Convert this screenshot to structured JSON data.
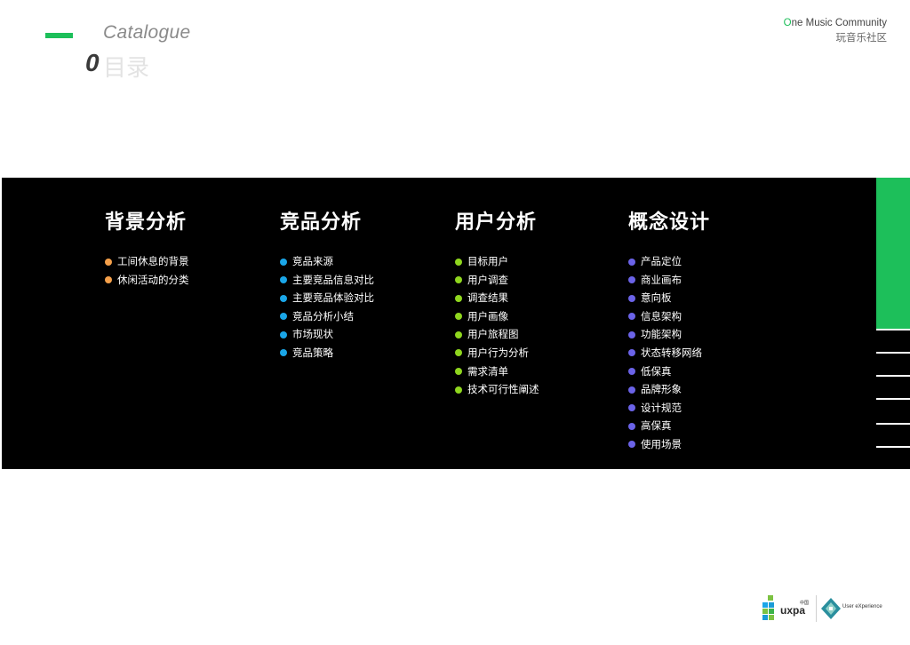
{
  "header": {
    "catalogue_label": "Catalogue",
    "index_number": "0",
    "index_text": "目录",
    "accent_color": "#1dbf5a"
  },
  "brand": {
    "name_first_letter": "O",
    "name_rest": "ne Music Community",
    "subtitle": "玩音乐社区"
  },
  "columns": [
    {
      "title": "背景分析",
      "dot_color": "#f5a04a",
      "items": [
        "工间休息的背景",
        "休闲活动的分类"
      ]
    },
    {
      "title": "竞品分析",
      "dot_color": "#1aa6e8",
      "items": [
        "竞品来源",
        "主要竞品信息对比",
        "主要竞品体验对比",
        "竞品分析小结",
        "市场现状",
        "竞品策略"
      ]
    },
    {
      "title": "用户分析",
      "dot_color": "#8fd61e",
      "items": [
        "目标用户",
        "用户调查",
        "调查结果",
        "用户画像",
        "用户旅程图",
        "用户行为分析",
        "需求清单",
        "技术可行性阐述"
      ]
    },
    {
      "title": "概念设计",
      "dot_color": "#6b63e8",
      "items": [
        "产品定位",
        "商业画布",
        "意向板",
        "信息架构",
        "功能架构",
        "状态转移网络",
        "低保真",
        "品牌形象",
        "设计规范",
        "高保真",
        "使用场景"
      ]
    }
  ],
  "footer_logos": {
    "uxpa_label": "uxpa",
    "uxpa_small": "中国",
    "ue_label": "User eXperience"
  }
}
